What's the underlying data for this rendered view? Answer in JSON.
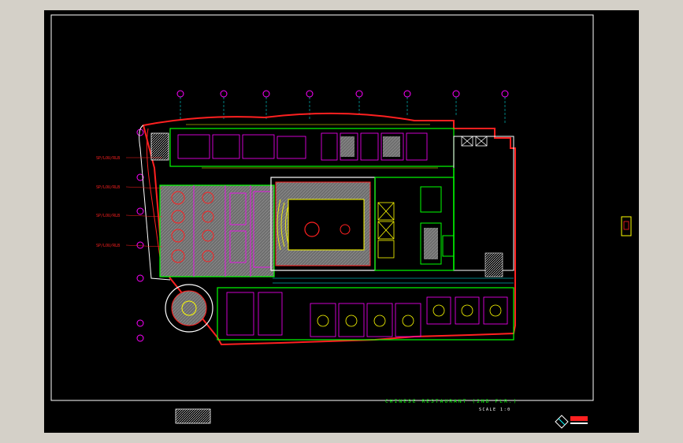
{
  "drawing": {
    "title": "CHINESE RESTAURANT (2ND FLR.)",
    "scale_label": "SCALE  1:0",
    "plan_annotations": [
      "SP/LOU/RLB",
      "SP/LOU/RLB",
      "SP/LOU/RLB",
      "SP/LOU/RLB"
    ]
  },
  "colors": {
    "canvas": "#000000",
    "frame": "#ffffff",
    "wall": "#ff2020",
    "partition": "#00ff00",
    "furniture": "#ff00ff",
    "dimension": "#ffff00",
    "cyan": "#00ffff",
    "grid_bubble": "#ff00ff",
    "hatch": "#7a7a7a",
    "title_text": "#00ff00"
  },
  "icons": {
    "logo": "company-logo-icon",
    "legend_block": "hatch-legend-icon",
    "grid_bubble": "grid-bubble-icon"
  }
}
